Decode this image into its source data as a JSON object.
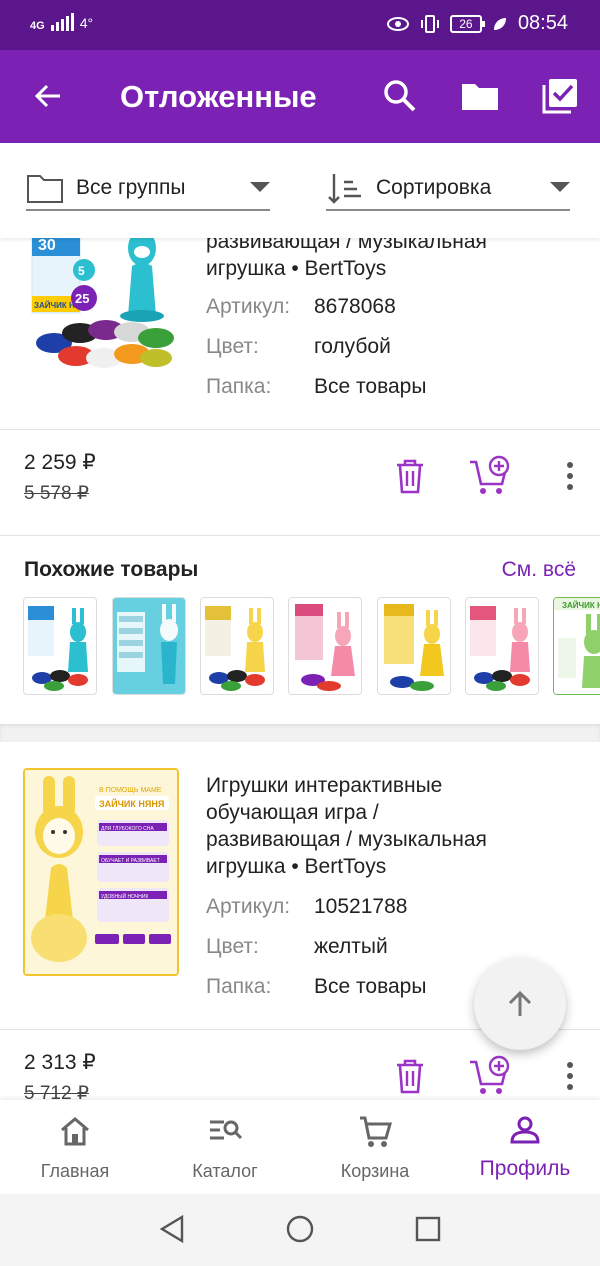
{
  "status_bar": {
    "network": "4G",
    "signal_extra": "4°",
    "battery": "26",
    "time": "08:54"
  },
  "app_bar": {
    "title": "Отложенные",
    "icons": [
      "arrow-left-icon",
      "search-icon",
      "folder-icon",
      "checklist-icon"
    ]
  },
  "filters": {
    "group": "Все группы",
    "sort": "Сортировка"
  },
  "product1": {
    "title_lines": [
      "развивающая / музыкальная",
      "игрушка • BertToys"
    ],
    "article_label": "Артикул:",
    "article": "8678068",
    "color_label": "Цвет:",
    "color": "голубой",
    "folder_label": "Папка:",
    "folder": "Все товары",
    "price": "2 259 ₽",
    "old_price": "5 578 ₽",
    "box_texts": [
      "30",
      "5",
      "25",
      "ЗАЙЧИК НЯНЯ"
    ]
  },
  "similar": {
    "title": "Похожие товары",
    "see_all": "См. всё",
    "thumb_text": "ЗАЙЧИК НЯ"
  },
  "product2": {
    "title_lines": [
      "Игрушки интерактивные",
      "обучающая игра /",
      "развивающая / музыкальная",
      "игрушка • BertToys"
    ],
    "article_label": "Артикул:",
    "article": "10521788",
    "color_label": "Цвет:",
    "color": "желтый",
    "folder_label": "Папка:",
    "folder": "Все товары",
    "price": "2 313 ₽",
    "old_price": "5 712 ₽",
    "poster_texts": [
      "В ПОМОЩЬ МАМЕ",
      "ЗАЙЧИК НЯНЯ",
      "ДЛЯ ГЛУБОКОГО СНА",
      "ОБУЧАЕТ И РАЗВИВАЕТ",
      "УДОБНЫЙ НОЧНИК"
    ]
  },
  "bottom_nav": [
    {
      "label": "Главная",
      "icon": "home-icon"
    },
    {
      "label": "Каталог",
      "icon": "catalog-search-icon"
    },
    {
      "label": "Корзина",
      "icon": "cart-icon"
    },
    {
      "label": "Профиль",
      "icon": "profile-icon"
    }
  ],
  "colors": {
    "accent": "#7b22b4",
    "status_bar": "#5a168a",
    "teal_toy": "#2bbfd0",
    "yellow_toy": "#f7d54a"
  }
}
